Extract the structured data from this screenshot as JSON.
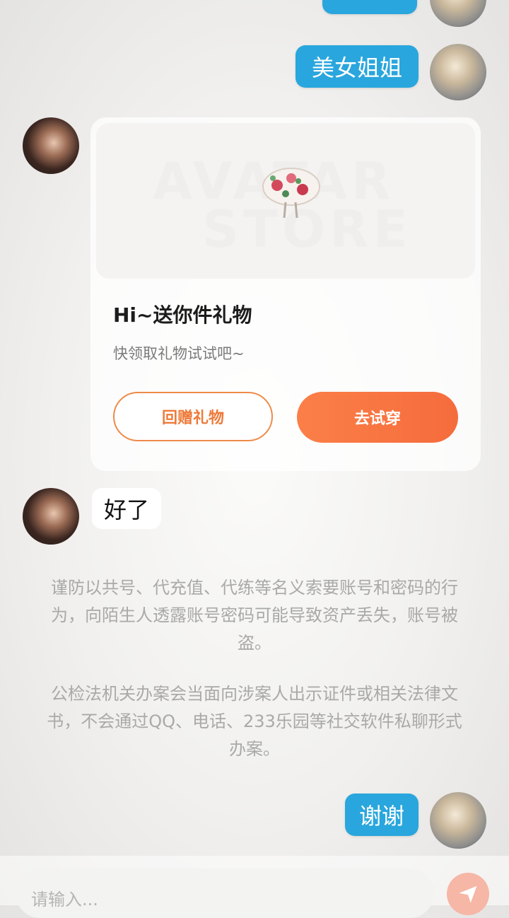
{
  "messages": [
    {
      "from": "me",
      "text": "美女姐姐"
    },
    {
      "from": "other",
      "type": "gift_card"
    },
    {
      "from": "other",
      "text": "好了"
    },
    {
      "from": "me",
      "text": "谢谢"
    }
  ],
  "gift_card": {
    "image_watermark_line1": "AVATAR",
    "image_watermark_line2": "STORE",
    "title": "Hi~送你件礼物",
    "subtitle": "快领取礼物试试吧~",
    "return_gift_label": "回赠礼物",
    "try_on_label": "去试穿"
  },
  "notices": [
    "谨防以共号、代充值、代练等名义索要账号和密码的行为，向陌生人透露账号密码可能导致资产丢失，账号被盗。",
    "公检法机关办案会当面向涉案人出示证件或相关法律文书，不会通过QQ、电话、233乐园等社交软件私聊形式办案。"
  ],
  "input": {
    "placeholder": "请输入..."
  },
  "colors": {
    "my_bubble": "#29a6dd",
    "accent_orange": "#f56c3c",
    "notice_text": "#a9a9a9"
  },
  "icons": {
    "send": "send-icon"
  }
}
